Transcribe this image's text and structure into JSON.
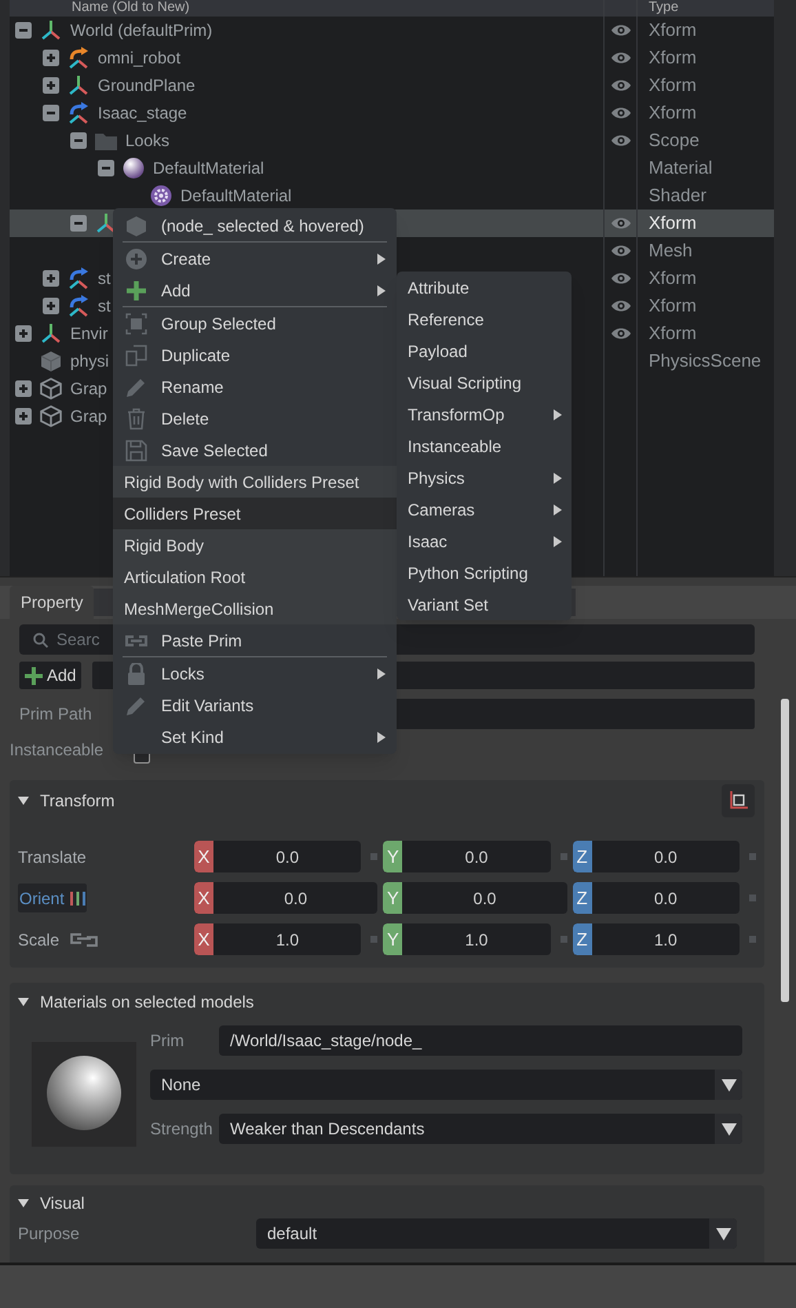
{
  "stage": {
    "columns": [
      "Name (Old to New)",
      "Type"
    ],
    "items": [
      {
        "name": "World (defaultPrim)",
        "kind": "axes",
        "expanded": true,
        "visible": true,
        "type": "Xform",
        "selected": false,
        "children": [
          {
            "name": "omni_robot",
            "kind": "axes_arrow",
            "color": "#e8862a",
            "expanded": false,
            "visible": true,
            "type": "Xform",
            "selected": false
          },
          {
            "name": "GroundPlane",
            "kind": "axes",
            "expanded": false,
            "visible": true,
            "type": "Xform",
            "selected": false
          },
          {
            "name": "Isaac_stage",
            "kind": "axes_arrow",
            "color": "#3a78e0",
            "expanded": true,
            "visible": true,
            "type": "Xform",
            "selected": false,
            "children": [
              {
                "name": "Looks",
                "kind": "folder",
                "expanded": true,
                "visible": true,
                "type": "Scope",
                "selected": false,
                "children": [
                  {
                    "name": "DefaultMaterial",
                    "kind": "material",
                    "expanded": true,
                    "visible": false,
                    "type": "Material",
                    "selected": false,
                    "children": [
                      {
                        "name": "DefaultMaterial",
                        "kind": "shader",
                        "visible": false,
                        "type": "Shader",
                        "selected": false
                      }
                    ]
                  }
                ]
              },
              {
                "kind": "axes",
                "expanded": true,
                "visible": true,
                "type": "Xform",
                "selected": true,
                "children": [
                  {
                    "kind": "hidden",
                    "visible": true,
                    "type": "Mesh",
                    "selected": false
                  }
                ]
              }
            ]
          },
          {
            "name": "st",
            "kind": "axes_arrow",
            "color": "#3a78e0",
            "expanded": false,
            "visible": true,
            "type": "Xform",
            "selected": false
          },
          {
            "name": "st",
            "kind": "axes_arrow",
            "color": "#3a78e0",
            "expanded": false,
            "visible": true,
            "type": "Xform",
            "selected": false
          }
        ]
      },
      {
        "name": "Envir",
        "kind": "axes",
        "expanded": false,
        "visible": true,
        "type": "Xform",
        "selected": false
      },
      {
        "name": "physi",
        "kind": "cube",
        "visible": false,
        "type": "PhysicsScene",
        "selected": false
      },
      {
        "name": "Grap",
        "kind": "graph",
        "expanded": false,
        "visible": false,
        "selected": false
      },
      {
        "name": "Grap",
        "kind": "graph",
        "expanded": false,
        "visible": false,
        "selected": false
      }
    ]
  },
  "context_menu": {
    "items": [
      {
        "kind": "header",
        "label": "(node_ selected & hovered)"
      },
      {
        "kind": "separator"
      },
      {
        "kind": "item",
        "label": "Create",
        "submenu": true,
        "highlighted": false
      },
      {
        "kind": "item",
        "label": "Add",
        "submenu": true,
        "highlighted": false
      },
      {
        "kind": "separator"
      },
      {
        "kind": "item",
        "label": "Group Selected",
        "submenu": false,
        "highlighted": false
      },
      {
        "kind": "item",
        "label": "Duplicate",
        "submenu": false,
        "highlighted": false
      },
      {
        "kind": "item",
        "label": "Rename",
        "submenu": false,
        "highlighted": false
      },
      {
        "kind": "item",
        "label": "Delete",
        "submenu": false,
        "highlighted": false
      },
      {
        "kind": "item",
        "label": "Save Selected",
        "submenu": false,
        "highlighted": false
      },
      {
        "kind": "preset",
        "label": "Rigid Body with Colliders Preset",
        "highlighted": false
      },
      {
        "kind": "preset",
        "label": "Colliders Preset",
        "highlighted": true
      },
      {
        "kind": "preset",
        "label": "Rigid Body",
        "highlighted": false
      },
      {
        "kind": "preset",
        "label": "Articulation Root",
        "highlighted": false
      },
      {
        "kind": "preset",
        "label": "MeshMergeCollision",
        "highlighted": false
      },
      {
        "kind": "item",
        "label": "Paste Prim",
        "submenu": false,
        "highlighted": false
      },
      {
        "kind": "separator"
      },
      {
        "kind": "item",
        "label": "Locks",
        "submenu": true,
        "highlighted": false
      },
      {
        "kind": "item",
        "label": "Edit Variants",
        "submenu": false,
        "highlighted": false
      },
      {
        "kind": "item",
        "label": "Set Kind",
        "submenu": true,
        "highlighted": false
      }
    ]
  },
  "add_submenu": {
    "items": [
      {
        "label": "Attribute",
        "submenu": false
      },
      {
        "label": "Reference",
        "submenu": false
      },
      {
        "label": "Payload",
        "submenu": false
      },
      {
        "label": "Visual Scripting",
        "submenu": false
      },
      {
        "label": "TransformOp",
        "submenu": true
      },
      {
        "label": "Instanceable",
        "submenu": false
      },
      {
        "label": "Physics",
        "submenu": true
      },
      {
        "label": "Cameras",
        "submenu": true
      },
      {
        "label": "Isaac",
        "submenu": true
      },
      {
        "label": "Python Scripting",
        "submenu": false
      },
      {
        "label": "Variant Set",
        "submenu": false
      }
    ]
  },
  "property": {
    "tab": "Property",
    "search": {
      "placeholder": "Searc"
    },
    "add_button": "Add",
    "prim_path_label": "Prim Path",
    "instanceable": {
      "label": "Instanceable",
      "checked": false
    },
    "transform": {
      "title": "Transform",
      "expanded": true,
      "rows": [
        {
          "label": "Translate",
          "kind": "vector",
          "values": [
            {
              "axis": "X",
              "color": "#b95555",
              "value": "0.0"
            },
            {
              "axis": "Y",
              "color": "#6da86d",
              "value": "0.0"
            },
            {
              "axis": "Z",
              "color": "#4a7db3",
              "value": "0.0"
            }
          ]
        },
        {
          "label": "Orient",
          "kind": "rotation",
          "values": [
            {
              "axis": "X",
              "color": "#b95555",
              "value": "0.0"
            },
            {
              "axis": "Y",
              "color": "#6da86d",
              "value": "0.0"
            },
            {
              "axis": "Z",
              "color": "#4a7db3",
              "value": "0.0"
            }
          ]
        },
        {
          "label": "Scale",
          "kind": "scale",
          "values": [
            {
              "axis": "X",
              "color": "#b95555",
              "value": "1.0"
            },
            {
              "axis": "Y",
              "color": "#6da86d",
              "value": "1.0"
            },
            {
              "axis": "Z",
              "color": "#4a7db3",
              "value": "1.0"
            }
          ]
        }
      ]
    },
    "materials": {
      "title": "Materials on selected models",
      "expanded": true,
      "prim_label": "Prim",
      "prim_value": "/World/Isaac_stage/node_",
      "material": "None",
      "strength_label": "Strength",
      "strength": "Weaker than Descendants"
    },
    "visual": {
      "title": "Visual",
      "expanded": true,
      "purpose_label": "Purpose",
      "purpose": "default"
    }
  }
}
